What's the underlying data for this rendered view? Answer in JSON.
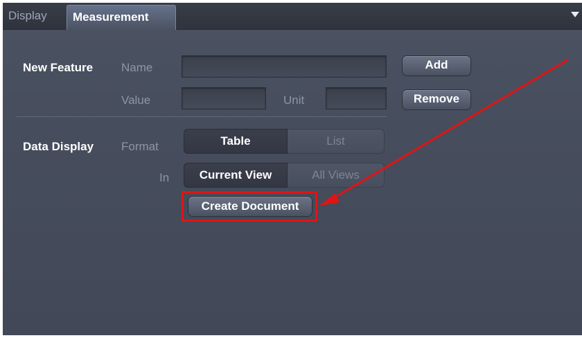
{
  "tabs": [
    {
      "label": "Display",
      "active": false
    },
    {
      "label": "Measurement",
      "active": true
    }
  ],
  "new_feature": {
    "section_label": "New Feature",
    "name_label": "Name",
    "name_value": "",
    "value_label": "Value",
    "value_value": "",
    "unit_label": "Unit",
    "unit_value": "",
    "add_label": "Add",
    "remove_label": "Remove"
  },
  "data_display": {
    "section_label": "Data Display",
    "format_label": "Format",
    "format_options": [
      "Table",
      "List"
    ],
    "format_selected": "Table",
    "in_label": "In",
    "in_options": [
      "Current View",
      "All Views"
    ],
    "in_selected": "Current View",
    "create_label": "Create Document"
  },
  "annotation": {
    "highlight_color": "#e11414",
    "arrow_color": "#e11414",
    "target": "Create Document"
  },
  "colors": {
    "panel_bg": "#464d5c",
    "tab_active_bg": "#5a6579",
    "text_primary": "#ffffff",
    "text_dim": "#8e96a6"
  }
}
